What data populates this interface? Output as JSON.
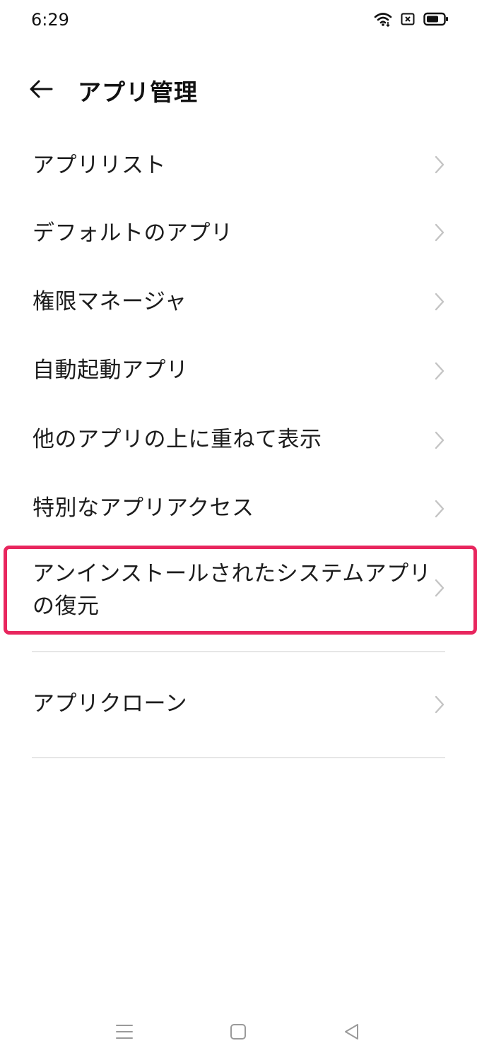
{
  "status_bar": {
    "time": "6:29"
  },
  "header": {
    "title": "アプリ管理"
  },
  "menu": {
    "items": [
      {
        "label": "アプリリスト"
      },
      {
        "label": "デフォルトのアプリ"
      },
      {
        "label": "権限マネージャ"
      },
      {
        "label": "自動起動アプリ"
      },
      {
        "label": "他のアプリの上に重ねて表示"
      },
      {
        "label": "特別なアプリアクセス"
      },
      {
        "label_line1": "アンインストールされたシステムアプリ",
        "label_line2": "の復元"
      },
      {
        "label": "アプリクローン"
      }
    ]
  },
  "colors": {
    "highlight": "#e8265e",
    "chevron": "#c4c4c4",
    "divider": "#e6e6e6"
  }
}
